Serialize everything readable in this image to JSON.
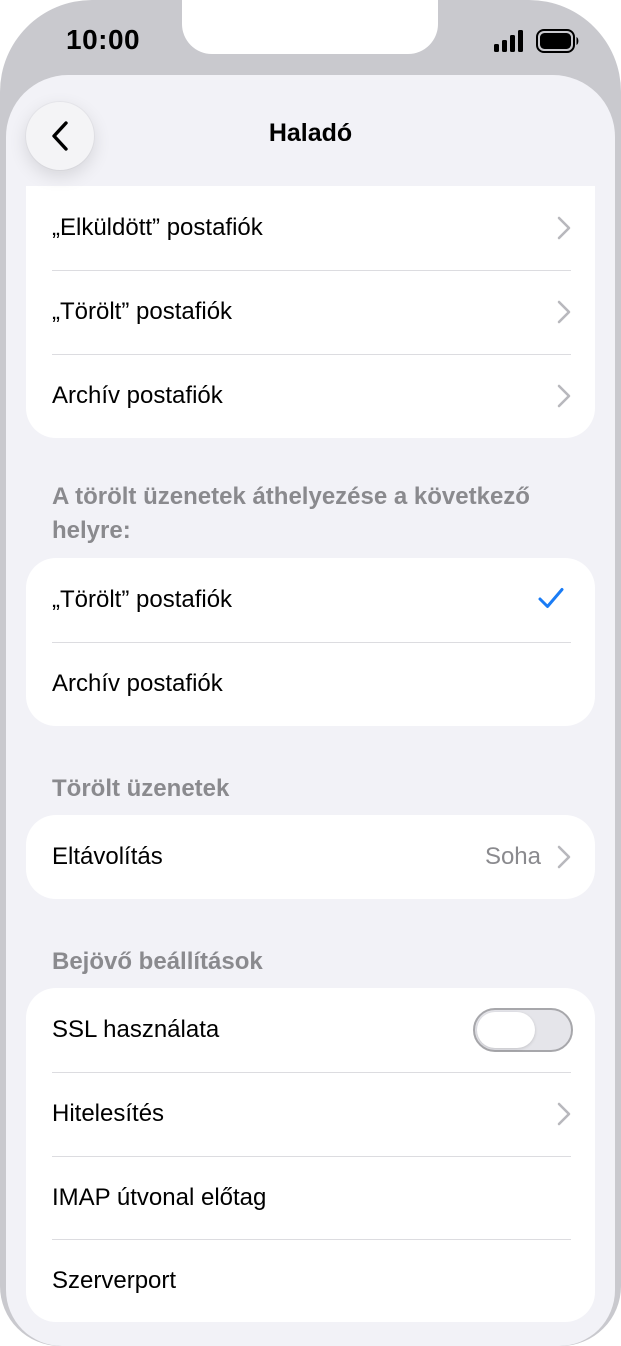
{
  "status_bar": {
    "time": "10:00"
  },
  "nav": {
    "title": "Haladó"
  },
  "mailbox_group": {
    "items": [
      {
        "label": "„Elküldött” postafiók"
      },
      {
        "label": "„Törölt” postafiók"
      },
      {
        "label": "Archív postafiók"
      }
    ]
  },
  "move_deleted": {
    "header": "A törölt üzenetek áthelyezése a következő helyre:",
    "items": [
      {
        "label": "„Törölt” postafiók",
        "selected": true
      },
      {
        "label": "Archív postafiók",
        "selected": false
      }
    ]
  },
  "deleted_messages": {
    "header": "Törölt üzenetek",
    "remove": {
      "label": "Eltávolítás",
      "value": "Soha"
    }
  },
  "incoming": {
    "header": "Bejövő beállítások",
    "ssl": {
      "label": "SSL használata",
      "enabled": false
    },
    "auth": {
      "label": "Hitelesítés"
    },
    "imap_prefix": {
      "label": "IMAP útvonal előtag"
    },
    "server_port": {
      "label": "Szerverport"
    }
  },
  "colors": {
    "accent": "#1a7cf5",
    "background": "#f2f2f7",
    "secondary_text": "#8a8a8e",
    "frame": "#c9c9ce"
  },
  "icons": {
    "back": "chevron-left-icon",
    "disclosure": "chevron-right-icon",
    "selected": "checkmark-icon",
    "signal": "cellular-signal-icon",
    "battery": "battery-icon"
  }
}
